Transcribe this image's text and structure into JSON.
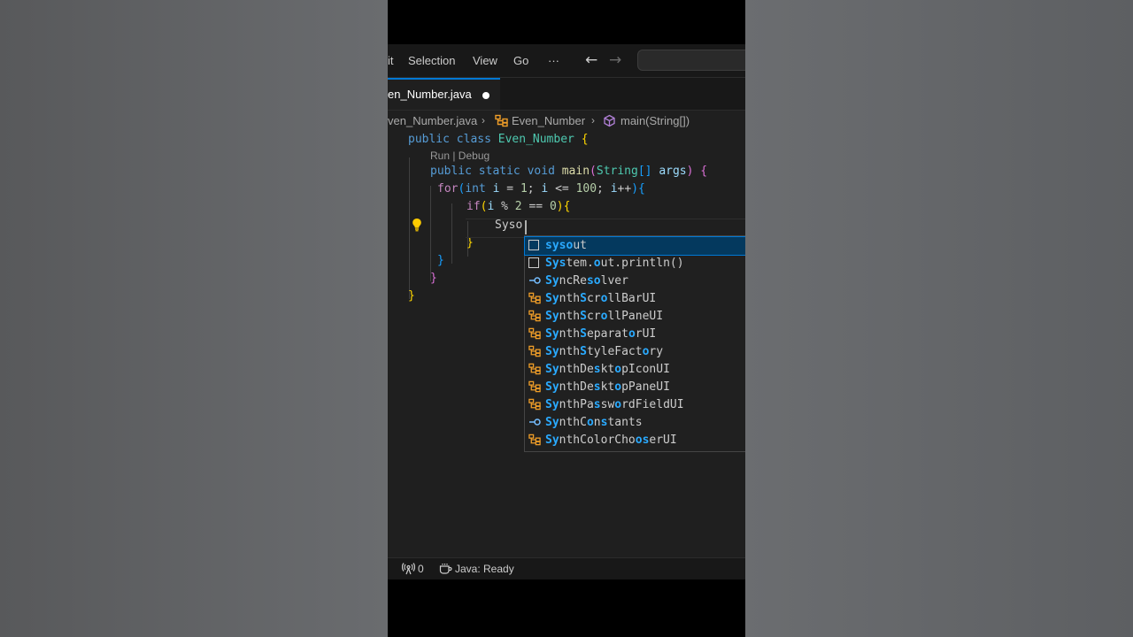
{
  "menubar": {
    "items": [
      "it",
      "Selection",
      "View",
      "Go",
      "···"
    ],
    "back_icon": "arrow-left-icon",
    "forward_icon": "arrow-right-icon"
  },
  "tab": {
    "label": "en_Number.java",
    "dirty_icon": "unsaved-dot-icon"
  },
  "breadcrumb": {
    "file": "ven_Number.java",
    "class_name": "Even_Number",
    "method": "main(String[])",
    "class_icon": "class-icon",
    "method_icon": "method-cube-icon",
    "separator_icon": "chevron-right-icon"
  },
  "editor": {
    "codelens": "Run | Debug",
    "lines": [
      "public class Even_Number {",
      "public static void main(String[] args) {",
      "for(int i = 1; i <= 100; i++){",
      "if(i % 2 == 0){",
      "Syso",
      "}",
      "}",
      "}",
      "}"
    ],
    "lightbulb_icon": "lightbulb-icon"
  },
  "suggestions": [
    {
      "label": "sysout",
      "kind": "snippet-icon",
      "selected": true
    },
    {
      "label": "System.out.println()",
      "kind": "snippet-icon"
    },
    {
      "label": "SyncResolver",
      "kind": "interface-icon"
    },
    {
      "label": "SynthScrollBarUI",
      "kind": "class-icon"
    },
    {
      "label": "SynthScrollPaneUI",
      "kind": "class-icon"
    },
    {
      "label": "SynthSeparatorUI",
      "kind": "class-icon"
    },
    {
      "label": "SynthStyleFactory",
      "kind": "class-icon"
    },
    {
      "label": "SynthDesktopIconUI",
      "kind": "class-icon"
    },
    {
      "label": "SynthDesktopPaneUI",
      "kind": "class-icon"
    },
    {
      "label": "SynthPasswordFieldUI",
      "kind": "class-icon"
    },
    {
      "label": "SynthConstants",
      "kind": "interface-icon"
    },
    {
      "label": "SynthColorChooserUI",
      "kind": "class-icon"
    }
  ],
  "statusbar": {
    "ports_icon": "broadcast-icon",
    "ports_count": "0",
    "java_icon": "coffee-cup-icon",
    "java_status": "Java: Ready"
  },
  "colors": {
    "accent": "#0078d4",
    "editor_bg": "#1f1f1f",
    "highlight": "#2aaaff"
  }
}
